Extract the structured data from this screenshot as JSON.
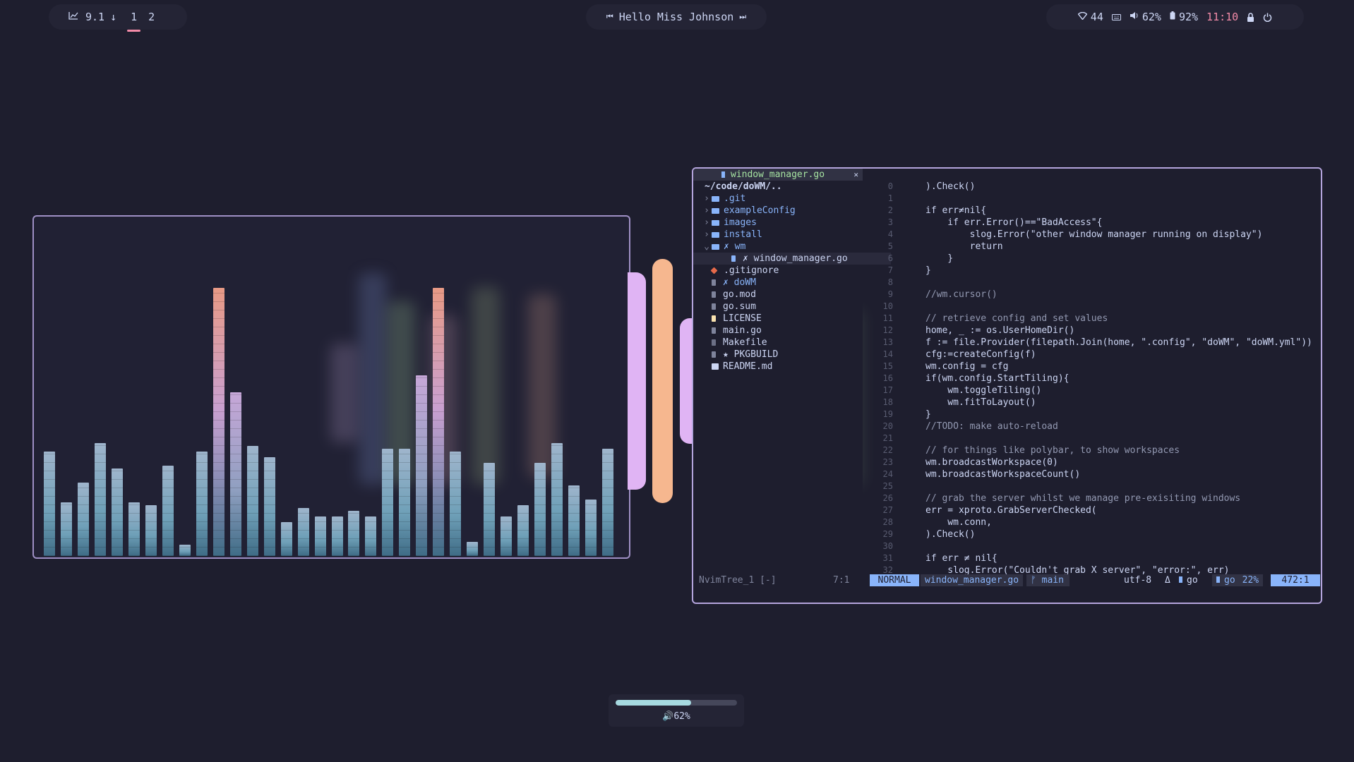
{
  "topbar": {
    "left": {
      "cpu_icon": "chart-line-icon",
      "cpu_value": "9.1",
      "arrow": "↓",
      "workspaces": [
        "1",
        "2"
      ],
      "active_workspace": "1"
    },
    "center": {
      "prev_icon": "⏮",
      "greeting": "Hello Miss Johnson",
      "next_icon": "⏭"
    },
    "right": {
      "wifi_value": "44",
      "volume_value": "62%",
      "battery_value": "92%",
      "time": "11:10"
    }
  },
  "visualizer": {
    "bar_levels": [
      0.37,
      0.19,
      0.26,
      0.4,
      0.31,
      0.19,
      0.18,
      0.32,
      0.04,
      0.37,
      0.95,
      0.58,
      0.39,
      0.35,
      0.12,
      0.17,
      0.14,
      0.14,
      0.16,
      0.14,
      0.38,
      0.38,
      0.64,
      0.95,
      0.37,
      0.05,
      0.33,
      0.14,
      0.18,
      0.33,
      0.4,
      0.25,
      0.2,
      0.38
    ]
  },
  "editor": {
    "tab_label": "window_manager.go",
    "tab_close": "✕",
    "tree_root": "~/code/doWM/..",
    "tree": [
      {
        "chev": "›",
        "kind": "dir",
        "name": ".git"
      },
      {
        "chev": "›",
        "kind": "dir",
        "name": "exampleConfig"
      },
      {
        "chev": "›",
        "kind": "dir",
        "name": "images"
      },
      {
        "chev": "›",
        "kind": "dir",
        "name": "install"
      },
      {
        "chev": "⌄",
        "kind": "dir-open",
        "name": "✗ wm"
      },
      {
        "chev": "",
        "kind": "file-sub",
        "name": "✗ window_manager.go"
      },
      {
        "chev": "",
        "kind": "git",
        "name": ".gitignore"
      },
      {
        "chev": "",
        "kind": "doc",
        "name": "✗ doWM"
      },
      {
        "chev": "",
        "kind": "file",
        "name": "go.mod"
      },
      {
        "chev": "",
        "kind": "file",
        "name": "go.sum"
      },
      {
        "chev": "",
        "kind": "lic",
        "name": "LICENSE"
      },
      {
        "chev": "",
        "kind": "file",
        "name": "main.go"
      },
      {
        "chev": "",
        "kind": "make",
        "name": "Makefile"
      },
      {
        "chev": "",
        "kind": "doc",
        "name": "★ PKGBUILD"
      },
      {
        "chev": "",
        "kind": "md",
        "name": "README.md"
      }
    ],
    "code_lines": [
      {
        "n": "0",
        "t": ").Check()"
      },
      {
        "n": "1",
        "t": ""
      },
      {
        "n": "2",
        "t": "if err≠nil{"
      },
      {
        "n": "3",
        "t": "    if err.Error()==\"BadAccess\"{"
      },
      {
        "n": "4",
        "t": "        slog.Error(\"other window manager running on display\")"
      },
      {
        "n": "5",
        "t": "        return"
      },
      {
        "n": "6",
        "t": "    }"
      },
      {
        "n": "7",
        "t": "}"
      },
      {
        "n": "8",
        "t": ""
      },
      {
        "n": "9",
        "t": "//wm.cursor()"
      },
      {
        "n": "10",
        "t": ""
      },
      {
        "n": "11",
        "t": "// retrieve config and set values"
      },
      {
        "n": "12",
        "t": "home, _ := os.UserHomeDir()"
      },
      {
        "n": "13",
        "t": "f := file.Provider(filepath.Join(home, \".config\", \"doWM\", \"doWM.yml\"))"
      },
      {
        "n": "14",
        "t": "cfg:=createConfig(f)"
      },
      {
        "n": "15",
        "t": "wm.config = cfg"
      },
      {
        "n": "16",
        "t": "if(wm.config.StartTiling){"
      },
      {
        "n": "17",
        "t": "    wm.toggleTiling()"
      },
      {
        "n": "18",
        "t": "    wm.fitToLayout()"
      },
      {
        "n": "19",
        "t": "}"
      },
      {
        "n": "20",
        "t": "//TODO: make auto-reload"
      },
      {
        "n": "21",
        "t": ""
      },
      {
        "n": "22",
        "t": "// for things like polybar, to show workspaces"
      },
      {
        "n": "23",
        "t": "wm.broadcastWorkspace(0)"
      },
      {
        "n": "24",
        "t": "wm.broadcastWorkspaceCount()"
      },
      {
        "n": "25",
        "t": ""
      },
      {
        "n": "26",
        "t": "// grab the server whilst we manage pre-exisiting windows"
      },
      {
        "n": "27",
        "t": "err = xproto.GrabServerChecked("
      },
      {
        "n": "28",
        "t": "    wm.conn,"
      },
      {
        "n": "29",
        "t": ").Check()"
      },
      {
        "n": "30",
        "t": ""
      },
      {
        "n": "31",
        "t": "if err ≠ nil{"
      },
      {
        "n": "32",
        "t": "    slog.Error(\"Couldn't grab X server\", \"error:\", err)"
      }
    ],
    "status": {
      "tree_name": "NvimTree_1 [-]",
      "tree_pos": "7:1",
      "mode": "NORMAL",
      "file": "window_manager.go",
      "branch_icon": "ᚠ",
      "branch": "main",
      "encoding": "utf-8",
      "delta": "Δ",
      "ft1": "go",
      "ft2": "go",
      "percent": "22%",
      "position": "472:1"
    }
  },
  "osd": {
    "volume_level": 0.62,
    "label": "🔊62%"
  }
}
